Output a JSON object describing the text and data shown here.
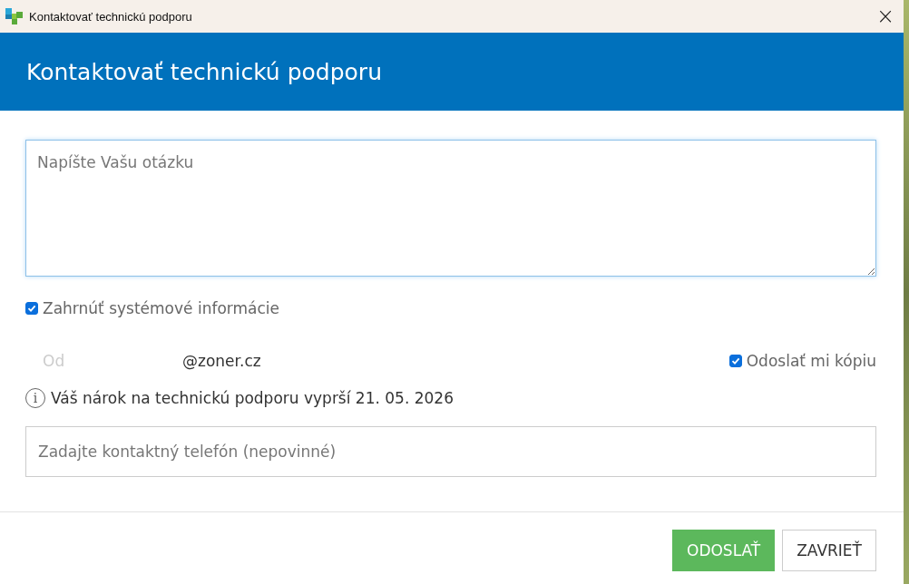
{
  "window": {
    "title": "Kontaktovať technickú podporu",
    "close": "×"
  },
  "header": {
    "title": "Kontaktovať technickú podporu"
  },
  "question": {
    "placeholder": "Napíšte Vašu otázku"
  },
  "include_system_info": {
    "label": "Zahrnúť systémové informácie",
    "checked": true
  },
  "from": {
    "label": "Od",
    "value": "@zoner.cz"
  },
  "send_copy": {
    "label": "Odoslať mi kópiu",
    "checked": true
  },
  "notice": {
    "icon": "i",
    "text": "Váš nárok na technickú podporu vyprší 21. 05. 2026"
  },
  "phone": {
    "placeholder": "Zadajte kontaktný telefón (nepovinné)"
  },
  "buttons": [
    {
      "label": "ODOSLAŤ",
      "kind": "primary"
    },
    {
      "label": "ZAVRIEŤ",
      "kind": "secondary"
    }
  ]
}
